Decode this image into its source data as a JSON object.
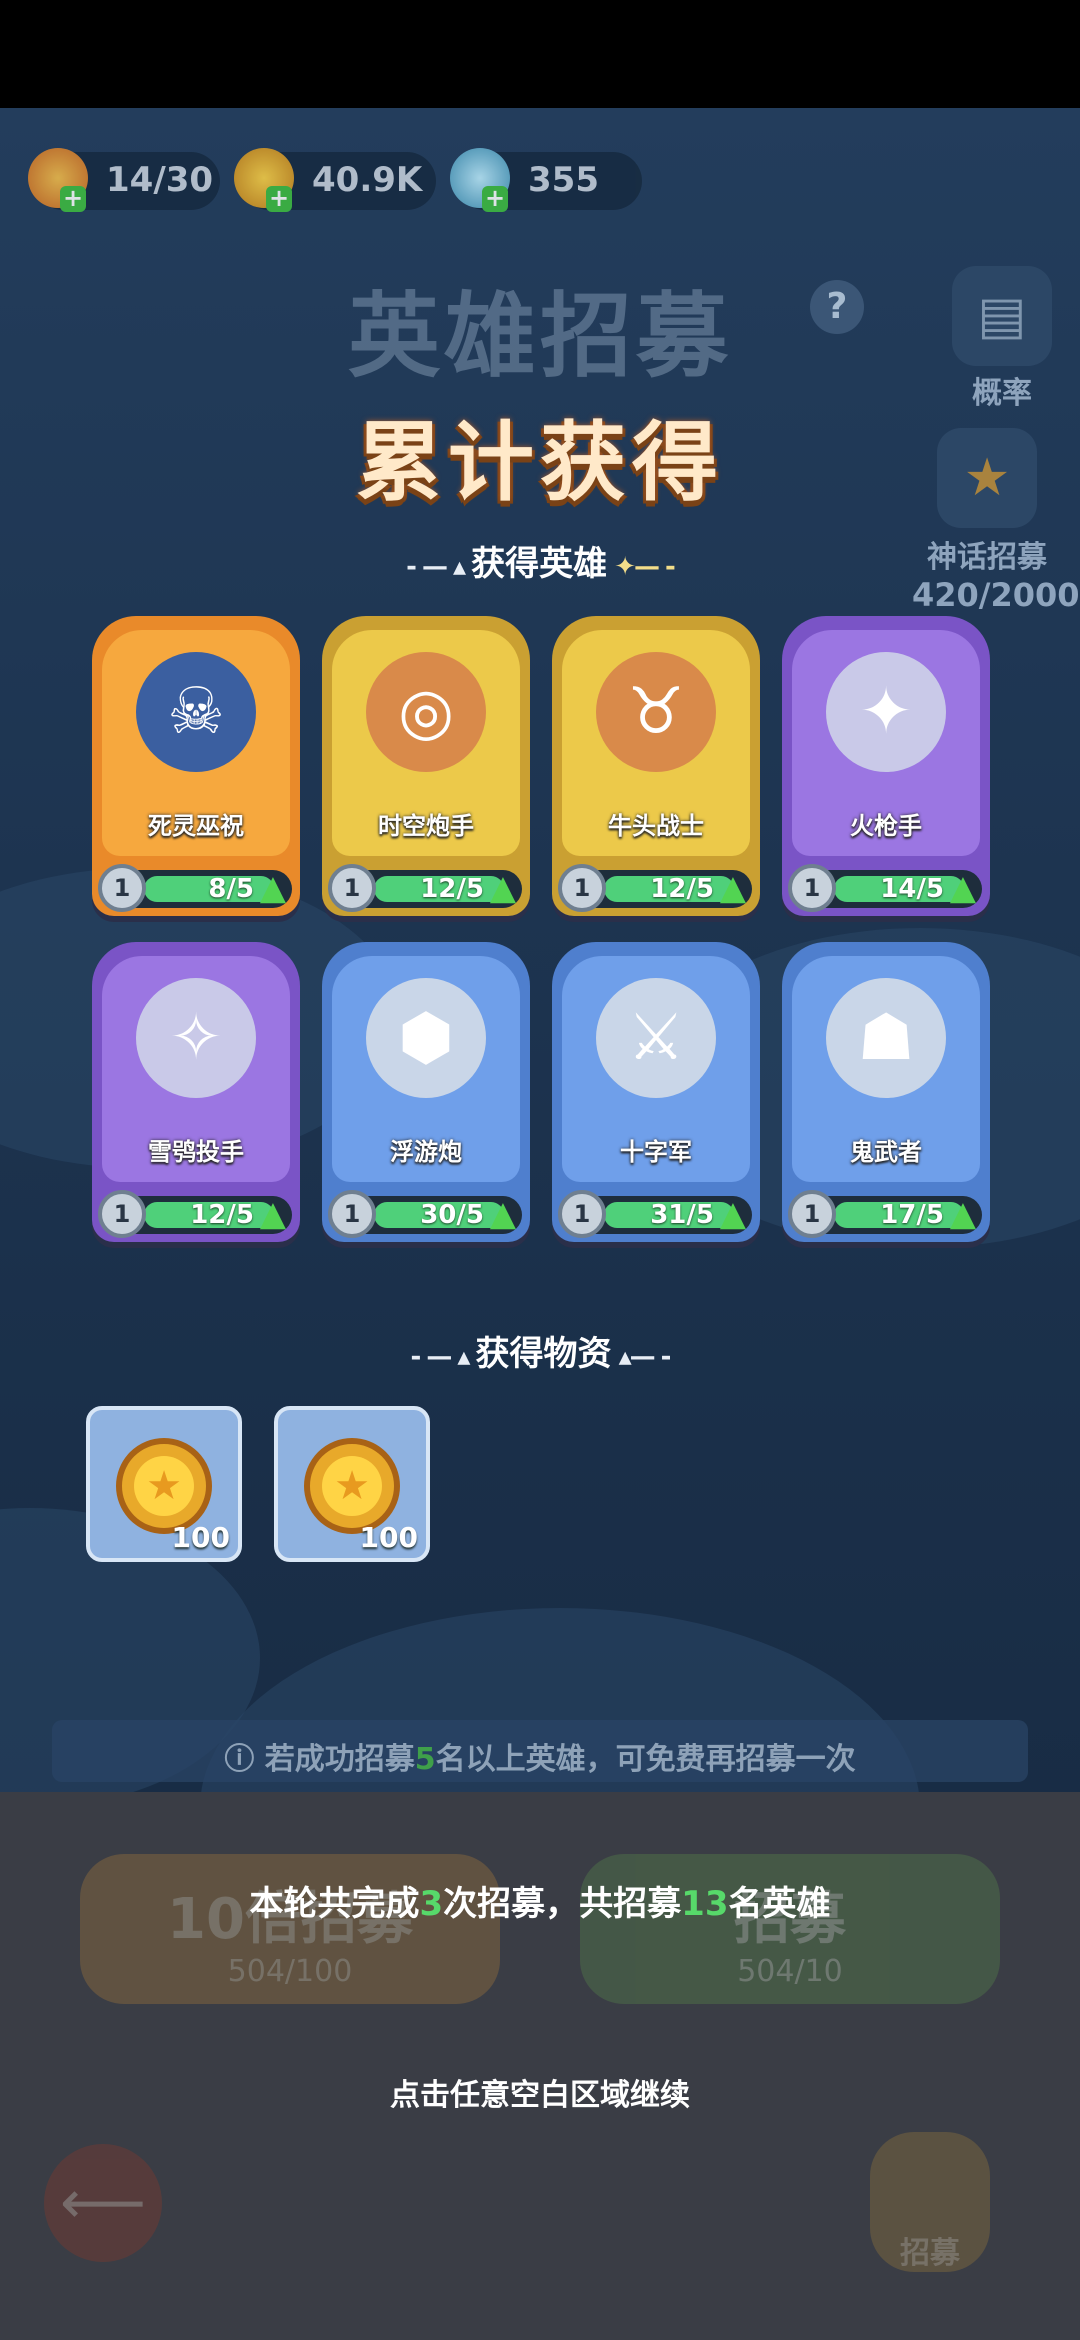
{
  "resources": {
    "stamina": "14/30",
    "gold": "40.9K",
    "gems": "355"
  },
  "header": {
    "title": "英雄招募",
    "help_icon": "?",
    "cumulative_title": "累计获得"
  },
  "side": {
    "rate_label": "概率",
    "myth_label": "神话招募",
    "myth_progress": "420/2000"
  },
  "sections": {
    "heroes_title": "获得英雄",
    "items_title": "获得物资"
  },
  "heroes": [
    {
      "name": "死灵巫祝",
      "level": "1",
      "progress": "8/5",
      "rarity": "orange"
    },
    {
      "name": "时空炮手",
      "level": "1",
      "progress": "12/5",
      "rarity": "gold"
    },
    {
      "name": "牛头战士",
      "level": "1",
      "progress": "12/5",
      "rarity": "gold"
    },
    {
      "name": "火枪手",
      "level": "1",
      "progress": "14/5",
      "rarity": "purple"
    },
    {
      "name": "雪鸮投手",
      "level": "1",
      "progress": "12/5",
      "rarity": "purple"
    },
    {
      "name": "浮游炮",
      "level": "1",
      "progress": "30/5",
      "rarity": "blue"
    },
    {
      "name": "十字军",
      "level": "1",
      "progress": "31/5",
      "rarity": "blue"
    },
    {
      "name": "鬼武者",
      "level": "1",
      "progress": "17/5",
      "rarity": "blue"
    }
  ],
  "items": [
    {
      "icon": "gold-coin-icon",
      "quantity": "100"
    },
    {
      "icon": "gold-coin-icon",
      "quantity": "100"
    }
  ],
  "tip": {
    "part1": "若成功招募",
    "count": "5",
    "part2": "名以上英雄，可免费再招募一次"
  },
  "bottom_ghost": {
    "btn1_label": "10倍招募",
    "btn1_cost": "504/100",
    "btn2_label": "招募",
    "btn2_cost": "504/10",
    "recruit_label": "招募"
  },
  "summary": {
    "part1": "本轮共完成",
    "rounds": "3",
    "part2": "次招募，共招募",
    "heroes": "13",
    "part3": "名英雄"
  },
  "continue_hint": "点击任意空白区域继续",
  "colors": {
    "orange_card": "#f29a2e",
    "gold_card": "#e9b93a",
    "purple_card": "#8b63d6",
    "blue_card": "#5d8fe0",
    "highlight": "#57d96a"
  }
}
